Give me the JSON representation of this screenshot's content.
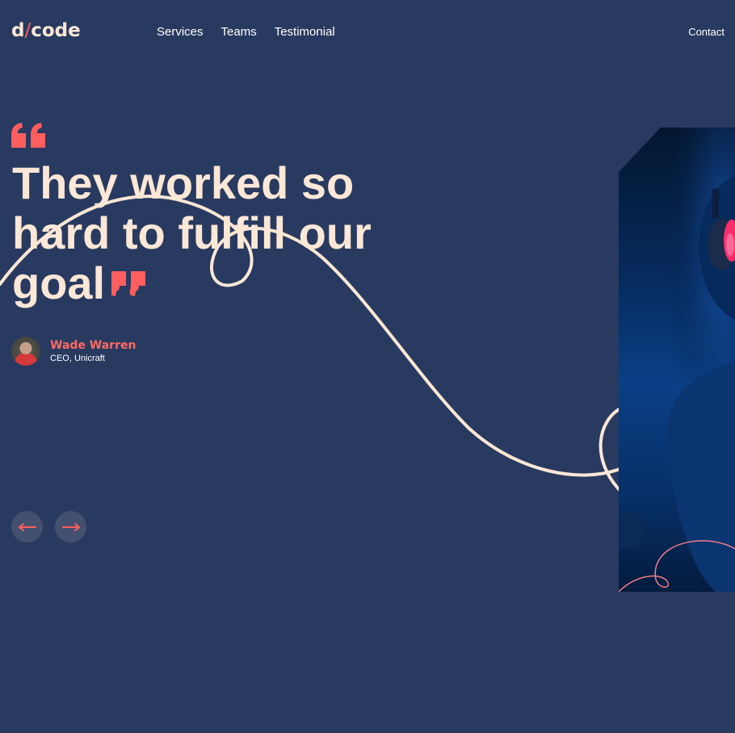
{
  "header": {
    "logo_left": "d",
    "logo_slash": "/",
    "logo_right": "code",
    "nav": [
      "Services",
      "Teams",
      "Testimonial"
    ],
    "contact": "Contact"
  },
  "testimonial": {
    "quote": "They worked so hard to fulfill our goal",
    "author_name": "Wade Warren",
    "author_role": "CEO, Unicraft"
  },
  "colors": {
    "background": "#293a60",
    "accent": "#ff5e5e",
    "cream": "#fbe7d6"
  },
  "icons": {
    "quote_open": "quote-open-icon",
    "quote_close": "quote-close-icon",
    "prev": "arrow-left-icon",
    "next": "arrow-right-icon"
  }
}
